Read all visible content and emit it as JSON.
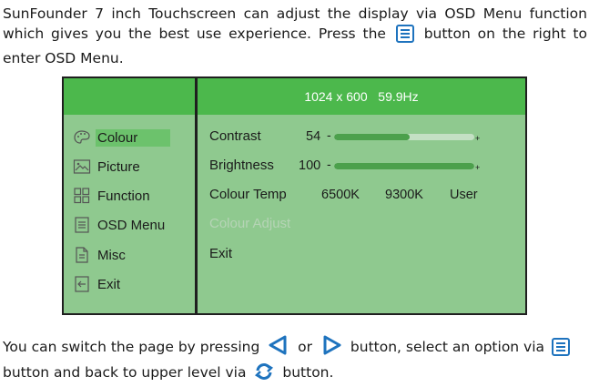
{
  "intro": {
    "before_icon": "SunFounder 7 inch Touchscreen can adjust the display via OSD Menu function which gives you the best use experience. Press the",
    "after_icon": "button on the right to enter OSD Menu."
  },
  "osd": {
    "resolution": "1024 x 600",
    "refresh": "59.9Hz",
    "menu": [
      {
        "label": "Colour",
        "icon": "palette-icon",
        "selected": true
      },
      {
        "label": "Picture",
        "icon": "picture-icon",
        "selected": false
      },
      {
        "label": "Function",
        "icon": "function-grid-icon",
        "selected": false
      },
      {
        "label": "OSD Menu",
        "icon": "osd-menu-icon",
        "selected": false
      },
      {
        "label": "Misc",
        "icon": "document-icon",
        "selected": false
      },
      {
        "label": "Exit",
        "icon": "exit-icon",
        "selected": false
      }
    ],
    "settings": {
      "contrast": {
        "label": "Contrast",
        "value": "54",
        "fill": 0.54
      },
      "brightness": {
        "label": "Brightness",
        "value": "100",
        "fill": 1.0
      },
      "colour_temp": {
        "label": "Colour Temp",
        "options": [
          "6500K",
          "9300K",
          "User"
        ]
      },
      "colour_adjust": {
        "label": "Colour Adjust"
      },
      "exit": {
        "label": "Exit"
      }
    },
    "colors": {
      "header": "#4cb84c",
      "panel": "#8fc98f",
      "selected": "#6cc26c",
      "icon_blue": "#1e73be"
    }
  },
  "outro": {
    "part1": "You can switch the page by pressing",
    "or": "or",
    "part2": "button, select an option via",
    "part3": "button and back to upper level via",
    "part4": "button."
  }
}
